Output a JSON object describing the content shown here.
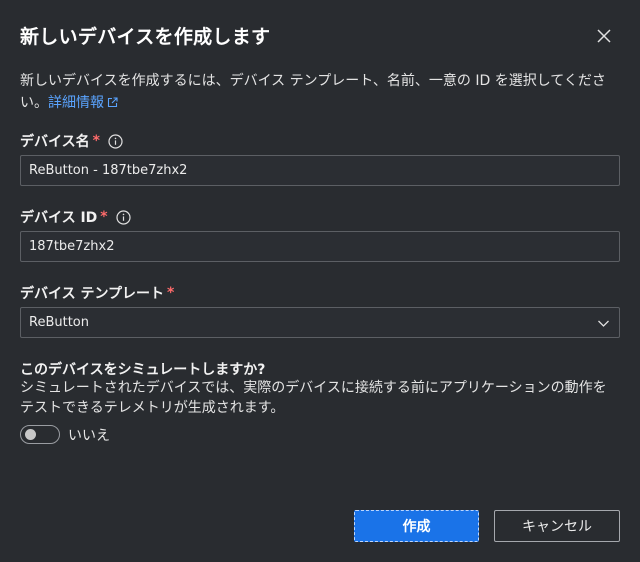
{
  "dialog": {
    "title": "新しいデバイスを作成します",
    "description": "新しいデバイスを作成するには、デバイス テンプレート、名前、一意の ID を選択してください。",
    "details_link": "詳細情報"
  },
  "fields": {
    "device_name": {
      "label": "デバイス名",
      "required_mark": "*",
      "value": "ReButton - 187tbe7zhx2"
    },
    "device_id": {
      "label": "デバイス ID",
      "required_mark": "*",
      "value": "187tbe7zhx2"
    },
    "device_template": {
      "label": "デバイス テンプレート",
      "required_mark": "*",
      "selected": "ReButton"
    }
  },
  "simulate": {
    "question": "このデバイスをシミュレートしますか?",
    "description": "シミュレートされたデバイスでは、実際のデバイスに接続する前にアプリケーションの動作をテストできるテレメトリが生成されます。",
    "toggle_on": false,
    "toggle_label": "いいえ"
  },
  "buttons": {
    "create": "作成",
    "cancel": "キャンセル"
  },
  "icons": [
    "close-icon",
    "info-icon",
    "external-link-icon",
    "chevron-down-icon"
  ],
  "colors": {
    "background": "#292c30",
    "accent": "#1a73e8",
    "link": "#5aa4ff",
    "required": "#ff6b6b"
  }
}
